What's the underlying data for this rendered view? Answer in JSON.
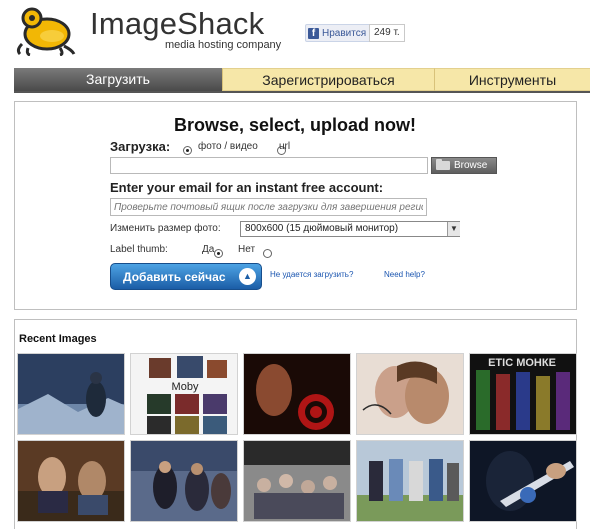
{
  "header": {
    "brand": "ImageShack",
    "tagline": "media hosting company",
    "fb_like": "Нравится",
    "fb_count": "249 т."
  },
  "tabs": [
    {
      "label": "Загрузить",
      "active": true
    },
    {
      "label": "Зарегистрироваться",
      "active": false
    },
    {
      "label": "Инструменты",
      "active": false
    }
  ],
  "upload": {
    "headline": "Browse, select, upload now!",
    "upload_label": "Загрузка:",
    "type_options": [
      "фото / видео",
      "url"
    ],
    "type_selected": "фото / видео",
    "browse_label": "Browse",
    "email_heading": "Enter your email for an instant free account:",
    "email_placeholder": "Проверьте почтовый ящик после загрузки для завершения регистрации",
    "resize_label": "Изменить размер фото:",
    "resize_value": "800x600 (15 дюймовый монитор)",
    "thumb_label": "Label thumb:",
    "thumb_options": [
      "Да",
      "Нет"
    ],
    "thumb_selected": "Да",
    "submit_label": "Добавить сейчас",
    "link_cant_upload": "Не удается загрузить?",
    "link_help": "Need help?"
  },
  "recent": {
    "title": "Recent Images",
    "thumb_text": [
      "Moby",
      "ЕТІС МОНКЕ"
    ]
  },
  "colors": {
    "tab_active": "#5a5a5a",
    "tab_inactive": "#f6e7a8",
    "submit_button": "#2b78c8",
    "link": "#1a55b0"
  }
}
